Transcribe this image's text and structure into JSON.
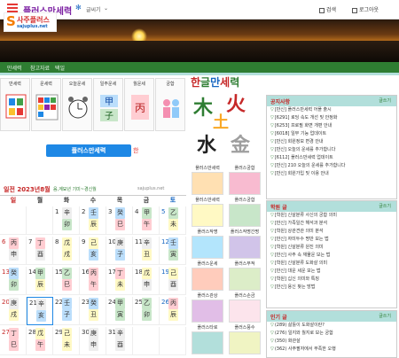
{
  "header": {
    "title": "플러스만세력",
    "font_label": "글씨기",
    "search_label": "검색",
    "login_label": "로그아웃"
  },
  "logo": {
    "name": "사주플러스",
    "url": "sajuplus.net"
  },
  "nav": {
    "items": [
      "만세력",
      "참고자료",
      "택일"
    ]
  },
  "tiles": [
    "만세력",
    "운세력",
    "오늘운세",
    "일주운세",
    "월운세",
    "궁합"
  ],
  "calc_button": "플러스만세력",
  "month": {
    "title": "일전 2023년8월",
    "sub": "음,계묘년 기미~경신월",
    "site": "sajuplus.net"
  },
  "weekdays": [
    "일",
    "월",
    "화",
    "수",
    "목",
    "금",
    "토"
  ],
  "calendar": [
    [
      {
        "d": "",
        "g": "",
        "j": ""
      },
      {
        "d": "",
        "g": "",
        "j": ""
      },
      {
        "d": "1",
        "g": "辛",
        "j": "卯"
      },
      {
        "d": "2",
        "g": "壬",
        "j": "辰"
      },
      {
        "d": "3",
        "g": "癸",
        "j": "巳"
      },
      {
        "d": "4",
        "g": "甲",
        "j": "午"
      },
      {
        "d": "5",
        "g": "乙",
        "j": "未"
      }
    ],
    [
      {
        "d": "6",
        "g": "丙",
        "j": "申"
      },
      {
        "d": "7",
        "g": "丁",
        "j": "酉"
      },
      {
        "d": "8",
        "g": "戊",
        "j": "戌"
      },
      {
        "d": "9",
        "g": "己",
        "j": "亥"
      },
      {
        "d": "10",
        "g": "庚",
        "j": "子"
      },
      {
        "d": "11",
        "g": "辛",
        "j": "丑"
      },
      {
        "d": "12",
        "g": "壬",
        "j": "寅"
      }
    ],
    [
      {
        "d": "13",
        "g": "癸",
        "j": "卯"
      },
      {
        "d": "14",
        "g": "甲",
        "j": "辰"
      },
      {
        "d": "15",
        "g": "乙",
        "j": "巳"
      },
      {
        "d": "16",
        "g": "丙",
        "j": "午"
      },
      {
        "d": "17",
        "g": "丁",
        "j": "未"
      },
      {
        "d": "18",
        "g": "戊",
        "j": "申"
      },
      {
        "d": "19",
        "g": "己",
        "j": "酉"
      }
    ],
    [
      {
        "d": "20",
        "g": "庚",
        "j": "戌"
      },
      {
        "d": "21",
        "g": "辛",
        "j": "亥"
      },
      {
        "d": "22",
        "g": "壬",
        "j": "子"
      },
      {
        "d": "23",
        "g": "癸",
        "j": "丑"
      },
      {
        "d": "24",
        "g": "甲",
        "j": "寅"
      },
      {
        "d": "25",
        "g": "乙",
        "j": "卯"
      },
      {
        "d": "26",
        "g": "丙",
        "j": "辰"
      }
    ],
    [
      {
        "d": "27",
        "g": "丁",
        "j": "巳"
      },
      {
        "d": "28",
        "g": "戊",
        "j": "午"
      },
      {
        "d": "29",
        "g": "己",
        "j": "未"
      },
      {
        "d": "30",
        "g": "庚",
        "j": "申"
      },
      {
        "d": "31",
        "g": "辛",
        "j": "酉"
      },
      {
        "d": "",
        "g": "",
        "j": ""
      },
      {
        "d": "",
        "g": "",
        "j": ""
      }
    ]
  ],
  "brand": {
    "part1": "한",
    "part2": "글",
    "part3": "만",
    "part4": "세",
    "part5": "력"
  },
  "han_chars": {
    "wood": "木",
    "fire": "火",
    "earth": "土",
    "water": "水",
    "metal": "金"
  },
  "thumbs": [
    "플러스만세력",
    "플러스궁합",
    "플러스만세력",
    "플러스궁합",
    "플러스작명",
    "플러스작명간명",
    "플러스운세",
    "플러스부적",
    "플러스관상",
    "플러스손금",
    "플러스타로",
    "플러스풍수"
  ],
  "panels": [
    {
      "title": "공지사항",
      "more": "글쓰기",
      "rows": [
        "[만신] 플러스만세력 어플 출시",
        "[6291] 로딩 속도 개선 및 안정화",
        "[6253] 프로필 화면 개편 안내",
        "[6018] 일부 기능 업데이트",
        "[만신] 회원정보 변경 안내",
        "[만신] 오늘의 운세를 추가합니다",
        "[6112] 플러스만세력 업데이트",
        "[만신] 210 오늘의 운세를 추가합니다",
        "[만신] 회원가입 및 이용 안내"
      ]
    },
    {
      "title": "학원 글",
      "more": "글쓰기",
      "rows": [
        "[학원] 신살분류 사신의 궁합 의미",
        "[만신] 가족일간 해석과 분석",
        "[학원] 상관견관 의미 분석",
        "[만신] 자미두수 명반 보는 법",
        "[학원] 신살분류 원진 의미",
        "[만신] 사주 속 재물운 보는 법",
        "[학원] 신살분류 도화살 의미",
        "[만신] 대운 세운 보는 법",
        "[학원] 십신 의미와 특징",
        "[만신] 용신 찾는 방법"
      ]
    },
    {
      "title": "인기 글",
      "more": "글쓰기",
      "rows": [
        "(289) 삶틀이 도화살이란?",
        "(276) 일지와 월지로 보는 궁합",
        "(350) 화관살",
        "(362) 사주팔자에서 부족한 오행"
      ]
    }
  ]
}
